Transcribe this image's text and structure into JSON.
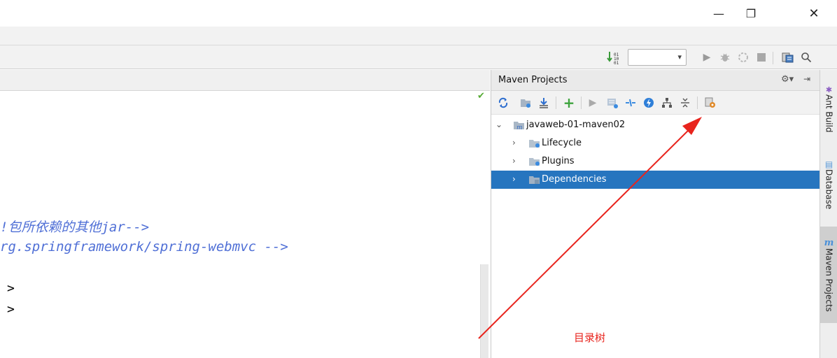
{
  "window_controls": {
    "minimize": "—",
    "maximize": "❐",
    "close": "✕"
  },
  "editor": {
    "code_lines": [
      "!包所依赖的其他jar-->",
      "rg.springframework/spring-webmvc -->"
    ],
    "gt_lines": [
      ">",
      ">"
    ]
  },
  "maven": {
    "title": "Maven Projects",
    "tree": [
      {
        "label": "javaweb-01-maven02",
        "expanded": true,
        "level": 0
      },
      {
        "label": "Lifecycle",
        "expanded": false,
        "level": 1
      },
      {
        "label": "Plugins",
        "expanded": false,
        "level": 1
      },
      {
        "label": "Dependencies",
        "expanded": false,
        "level": 1,
        "selected": true
      }
    ]
  },
  "annotation": {
    "label": "目录树",
    "color": "#e8241d"
  },
  "sidebar_tabs": [
    "Ant Build",
    "Database",
    "Maven Projects"
  ],
  "colors": {
    "selection": "#2675bf",
    "code_comment": "#4f6fd6",
    "add_green": "#3da33d"
  }
}
